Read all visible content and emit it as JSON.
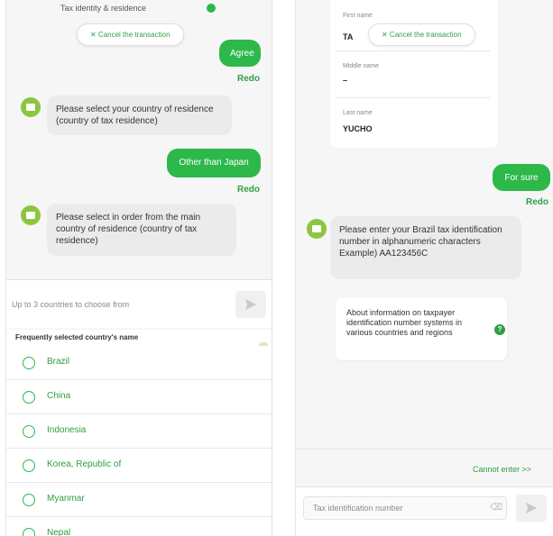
{
  "left": {
    "top_partial": "Tax identity & residence",
    "cancel_label": "✕ Cancel the transaction",
    "user_agree": "Agree",
    "redo_1": "Redo",
    "bot_msg_1": "Please select your country of residence (country of tax residence)",
    "user_other": "Other than Japan",
    "redo_2": "Redo",
    "bot_msg_2": "Please select in order from the main country of residence (country of tax residence)",
    "input_placeholder": "Up to 3 countries to choose from",
    "list_header": "Frequently selected country's name",
    "countries": [
      "Brazil",
      "China",
      "Indonesia",
      "Korea, Republic of",
      "Myanmar",
      "Nepal"
    ]
  },
  "right": {
    "first_name_label": "First name",
    "first_name_value": "TA",
    "cancel_label": "✕ Cancel the transaction",
    "middle_name_label": "Middle name",
    "middle_name_value": "–",
    "last_name_label": "Last name",
    "last_name_value": "YUCHO",
    "user_msg": "For sure",
    "redo": "Redo",
    "bot_msg": "Please enter your Brazil tax identification number in alphanumeric characters Example) AA123456C",
    "info_text": "About information on taxpayer identification number systems in various countries and regions",
    "info_icon": "?",
    "cannot_enter": "Cannot enter >>",
    "input_placeholder": "Tax identification number"
  },
  "colors": {
    "accent": "#2db84a",
    "link": "#2f9e44",
    "bot_bubble": "#ebebeb"
  }
}
